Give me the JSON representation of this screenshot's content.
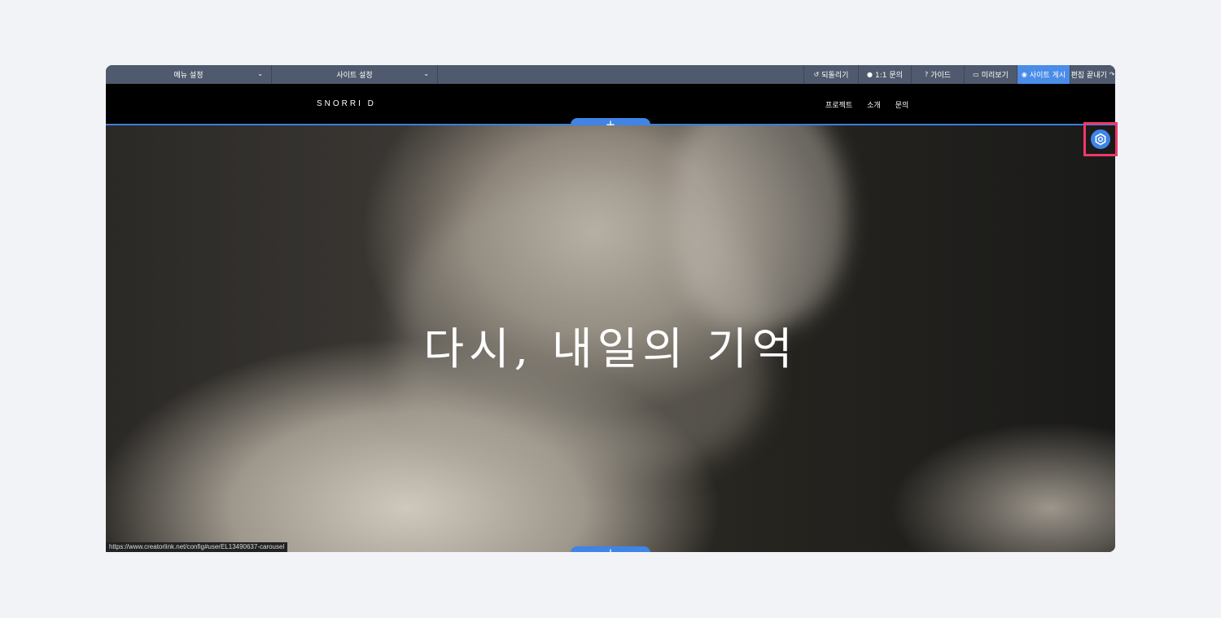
{
  "toolbar": {
    "menu_settings": "메뉴 설정",
    "site_settings": "사이트 설정",
    "undo": "되돌리기",
    "inquiry": "1:1 문의",
    "guide": "가이드",
    "preview": "미리보기",
    "publish": "사이트 게시",
    "finish": "편집 끝내기"
  },
  "site": {
    "logo": "SNORRI D",
    "nav": [
      "프로젝트",
      "소개",
      "문의"
    ]
  },
  "hero": {
    "title": "다시, 내일의 기억"
  },
  "add_section_symbol": "+",
  "status_url": "https://www.creatorlink.net/config#userEL13490637-carousel",
  "colors": {
    "toolbar_bg": "#4f5a6e",
    "accent": "#3f84e6",
    "highlight": "#f0386b"
  }
}
